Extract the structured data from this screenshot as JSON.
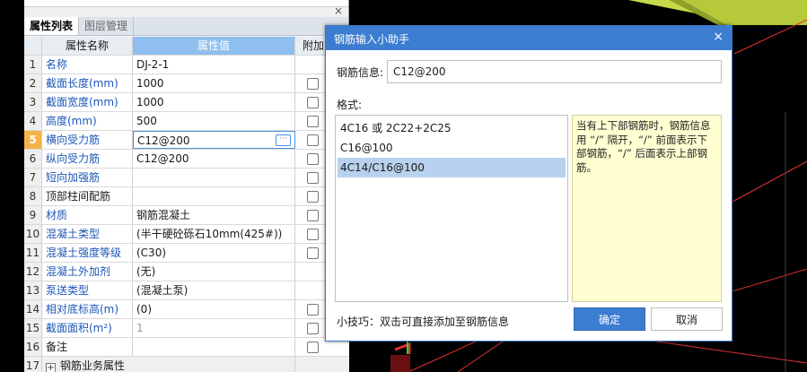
{
  "panel": {
    "tabs": [
      {
        "label": "属性列表"
      },
      {
        "label": "图层管理"
      }
    ],
    "close_glyph": "×",
    "headers": {
      "name": "属性名称",
      "value": "属性值",
      "add": "附加"
    },
    "rows": [
      {
        "idx": "1",
        "name": "名称",
        "value": "DJ-2-1",
        "blue": true
      },
      {
        "idx": "2",
        "name": "截面长度(mm)",
        "value": "1000",
        "blue": true
      },
      {
        "idx": "3",
        "name": "截面宽度(mm)",
        "value": "1000",
        "blue": true
      },
      {
        "idx": "4",
        "name": "高度(mm)",
        "value": "500",
        "blue": true
      },
      {
        "idx": "5",
        "name": "横向受力筋",
        "value": "C12@200",
        "blue": true
      },
      {
        "idx": "6",
        "name": "纵向受力筋",
        "value": "C12@200",
        "blue": true
      },
      {
        "idx": "7",
        "name": "短向加强筋",
        "value": "",
        "blue": true
      },
      {
        "idx": "8",
        "name": "顶部柱间配筋",
        "value": "",
        "blue": false
      },
      {
        "idx": "9",
        "name": "材质",
        "value": "钢筋混凝土",
        "blue": true
      },
      {
        "idx": "10",
        "name": "混凝土类型",
        "value": "(半干硬砼砾石10mm(425#))",
        "blue": true
      },
      {
        "idx": "11",
        "name": "混凝土强度等级",
        "value": "(C30)",
        "blue": true
      },
      {
        "idx": "12",
        "name": "混凝土外加剂",
        "value": "(无)",
        "blue": true
      },
      {
        "idx": "13",
        "name": "泵送类型",
        "value": "(混凝土泵)",
        "blue": true
      },
      {
        "idx": "14",
        "name": "相对底标高(m)",
        "value": "(0)",
        "blue": true
      },
      {
        "idx": "15",
        "name": "截面面积(m²)",
        "value": "1",
        "blue": true
      },
      {
        "idx": "16",
        "name": "备注",
        "value": "",
        "blue": false
      },
      {
        "idx": "17",
        "name": "钢筋业务属性",
        "value": "",
        "blue": false
      }
    ],
    "ellipsis": "···",
    "expand": "+"
  },
  "dialog": {
    "title": "钢筋输入小助手",
    "close_glyph": "×",
    "info_label": "钢筋信息:",
    "info_value": "C12@200",
    "format_label": "格式:",
    "formats": [
      "4C16 或 2C22+2C25",
      "C16@100",
      "4C14/C16@100"
    ],
    "hint": "当有上下部钢筋时，钢筋信息用 “/” 隔开，“/” 前面表示下部钢筋，“/” 后面表示上部钢筋。",
    "tip": "小技巧：双击可直接添加至钢筋信息",
    "ok": "确定",
    "cancel": "取消"
  },
  "colors": {
    "accent": "#3c7dd1",
    "selected_index": "#f5b24a",
    "value_header": "#8fbfee",
    "label_blue": "#1d57b8",
    "hint_bg": "#ffffd2",
    "viewport_bg": "#000000",
    "model_line": "#e03030",
    "model_block": "#b6c93a"
  }
}
